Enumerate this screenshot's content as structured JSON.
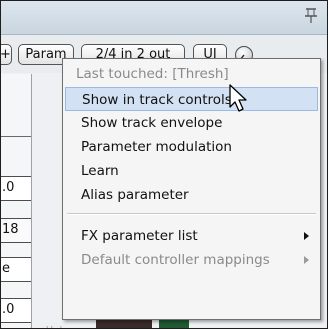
{
  "toolbar": {
    "add_label": "+",
    "param_label": "Param",
    "io_label": "2/4 in 2 out",
    "ui_label": "UI",
    "icons": [
      "pin-icon",
      "knob-icon"
    ]
  },
  "strip": {
    "values": [
      ".0",
      "18",
      "e",
      ".0"
    ]
  },
  "context_menu": {
    "header": "Last touched: [Thresh]",
    "items": [
      "Show in track controls",
      "Show track envelope",
      "Parameter modulation",
      "Learn",
      "Alias parameter"
    ],
    "submenus": [
      "FX parameter list",
      "Default controller mappings"
    ],
    "highlighted_item": "Show in track controls"
  },
  "colors": {
    "highlight_fill": "#d3e1f5",
    "highlight_border": "#9bb9e1",
    "disabled_text": "#8a8a8a"
  }
}
